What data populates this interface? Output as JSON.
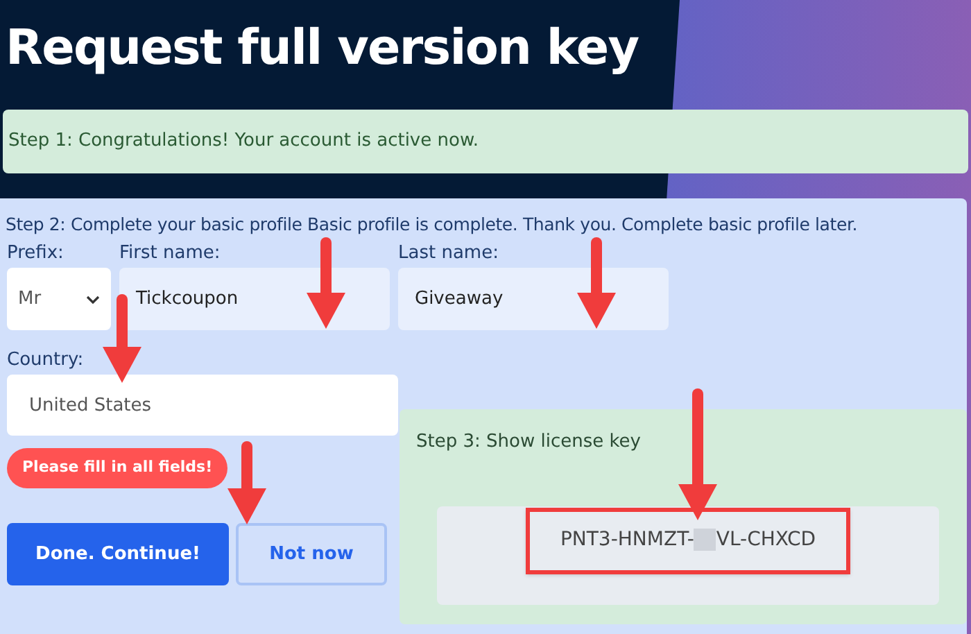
{
  "page_title": "Request full version key",
  "step1": {
    "message": "Step 1: Congratulations! Your account is active now."
  },
  "step2": {
    "message": "Step 2: Complete your basic profile Basic profile is complete. Thank you. Complete basic profile later.",
    "fields": [
      {
        "kind": "select",
        "label": "Prefix:",
        "value": "Mr"
      },
      {
        "kind": "text",
        "label": "First name:",
        "value": "Tickcoupon"
      },
      {
        "kind": "text",
        "label": "Last name:",
        "value": "Giveaway"
      }
    ],
    "country": {
      "label": "Country:",
      "value": "United States"
    },
    "error": "Please fill in all fields!",
    "buttons": [
      {
        "kind": "primary",
        "label": "Done. Continue!"
      },
      {
        "kind": "secondary",
        "label": "Not now"
      }
    ]
  },
  "step3": {
    "title": "Step 3: Show license key",
    "key_before": "PNT3-HNMZT-",
    "key_after": "VL-CHXCD"
  }
}
